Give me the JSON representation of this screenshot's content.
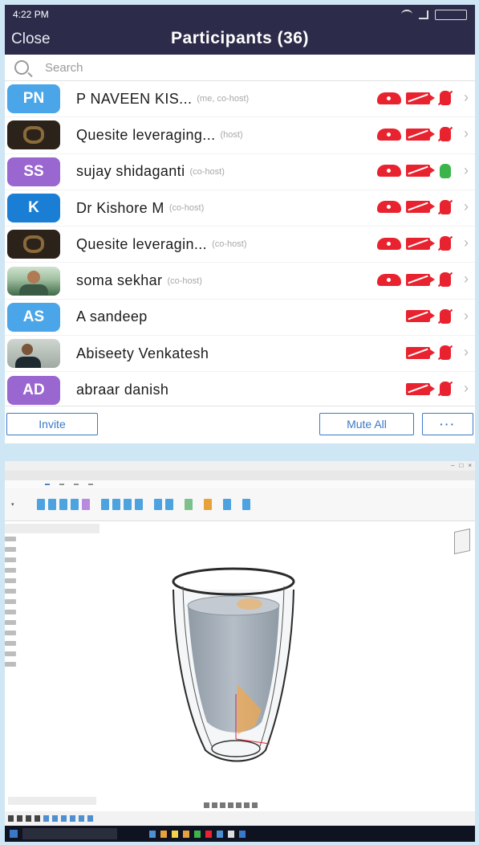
{
  "phone": {
    "status": {
      "time": "4:22 PM"
    },
    "header": {
      "close_label": "Close",
      "title": "Participants (36)"
    },
    "search": {
      "placeholder": "Search"
    },
    "participants": [
      {
        "initials": "PN",
        "name": "P NAVEEN KIS...",
        "role": "(me, co-host)",
        "avatar_color": "#4aa6e8",
        "mic": "muted",
        "video": "off",
        "recording": true
      },
      {
        "initials": "",
        "name": "Quesite leveraging...",
        "role": "(host)",
        "avatar": "logo",
        "mic": "muted",
        "video": "off",
        "recording": true
      },
      {
        "initials": "SS",
        "name": "sujay shidaganti",
        "role": "(co-host)",
        "avatar_color": "#9a66d0",
        "mic": "on",
        "video": "off",
        "recording": true
      },
      {
        "initials": "K",
        "name": "Dr Kishore M",
        "role": "(co-host)",
        "avatar_color": "#1a7fd4",
        "mic": "muted",
        "video": "off",
        "recording": true
      },
      {
        "initials": "",
        "name": "Quesite leveragin...",
        "role": "(co-host)",
        "avatar": "logo",
        "mic": "muted",
        "video": "off",
        "recording": true
      },
      {
        "initials": "",
        "name": "soma sekhar",
        "role": "(co-host)",
        "avatar": "photo",
        "mic": "muted",
        "video": "off",
        "recording": true
      },
      {
        "initials": "AS",
        "name": "A sandeep",
        "role": "",
        "avatar_color": "#4aa6e8",
        "mic": "muted",
        "video": "off",
        "recording": false
      },
      {
        "initials": "",
        "name": "Abiseety Venkatesh",
        "role": "",
        "avatar": "photo2",
        "mic": "muted",
        "video": "off",
        "recording": false
      },
      {
        "initials": "AD",
        "name": "abraar danish",
        "role": "",
        "avatar_color": "#9a66d0",
        "mic": "muted",
        "video": "off",
        "recording": false
      }
    ],
    "footer": {
      "invite_label": "Invite",
      "mute_all_label": "Mute All",
      "more_label": "···"
    },
    "colors": {
      "header_bg": "#2c2c4a",
      "accent": "#3a78c8",
      "muted_red": "#e8232f",
      "unmuted_green": "#3bb44a"
    }
  },
  "desktop": {
    "app": "CAD design application",
    "icons": [
      "glass-model-icon",
      "view-cube-icon",
      "ribbon-tool-icon",
      "taskbar-app-icon"
    ]
  }
}
